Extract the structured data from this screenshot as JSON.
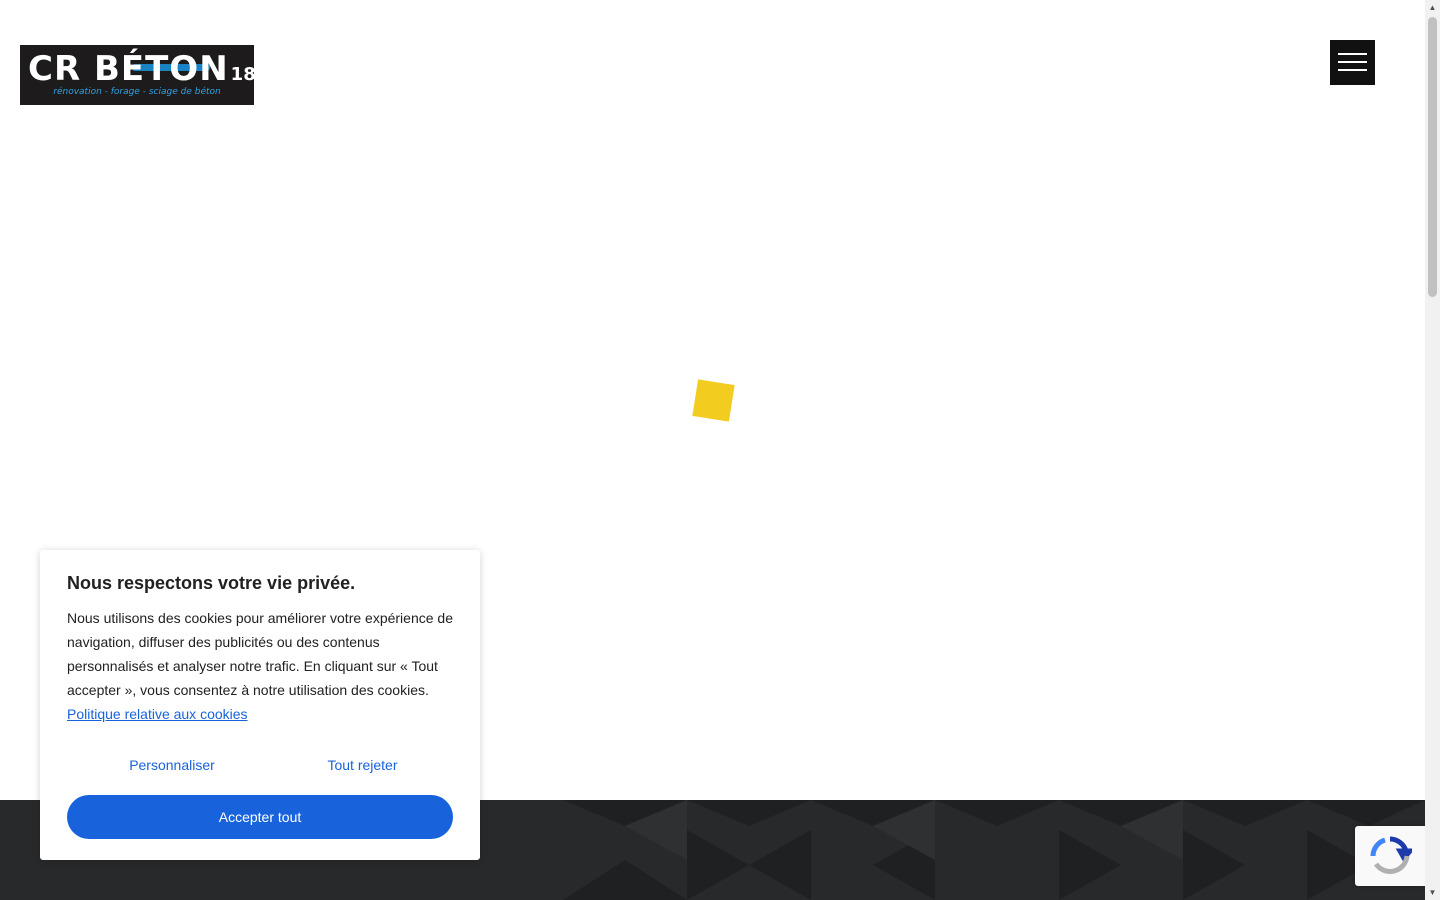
{
  "header": {
    "logo": {
      "brand": "CR BÉTON",
      "number": "18",
      "tagline": "rénovation - forage - sciage de béton"
    },
    "menu_icon": "hamburger-icon"
  },
  "loader": {
    "color": "#f2cd1f"
  },
  "cookie_banner": {
    "title": "Nous respectons votre vie privée.",
    "text": "Nous utilisons des cookies pour améliorer votre expérience de navigation, diffuser des publicités ou des contenus personnalisés et analyser notre trafic. En cliquant sur « Tout accepter », vous consentez à notre utilisation des cookies.",
    "policy_link": "Politique relative aux cookies",
    "customize_label": "Personnaliser",
    "reject_label": "Tout rejeter",
    "accept_label": "Accepter tout",
    "accent_color": "#1863dc"
  },
  "footer": {
    "background": "#28292b"
  },
  "recaptcha": {
    "icon": "recaptcha-icon"
  }
}
